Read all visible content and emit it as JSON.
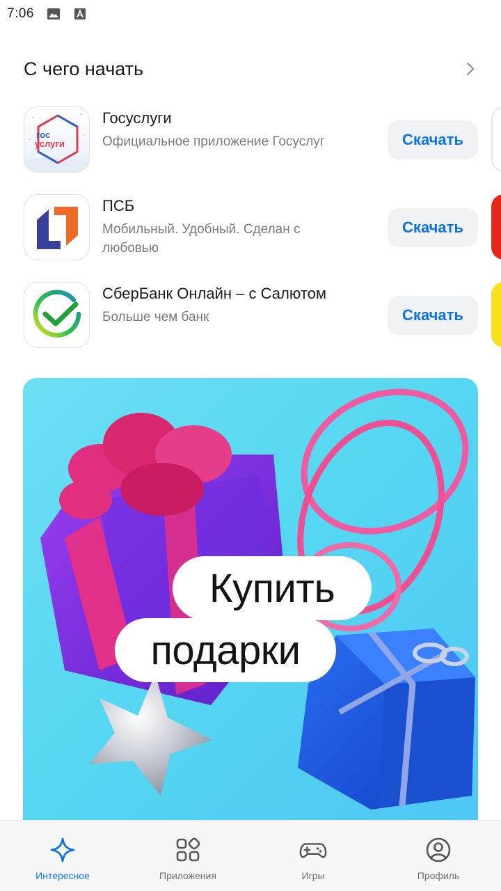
{
  "status_bar": {
    "time": "7:06",
    "icons": [
      "image-icon",
      "font-a-icon"
    ]
  },
  "section": {
    "title": "С чего начать"
  },
  "apps": [
    {
      "name": "Госуслуги",
      "description": "Официальное приложение Госуслуг",
      "button": "Скачать",
      "icon": "gosuslugi-logo",
      "icon_text_1": "гос",
      "icon_text_2": "услуги"
    },
    {
      "name": "ПСБ",
      "description": "Мобильный. Удобный. Сделан с любовью",
      "button": "Скачать",
      "icon": "psb-logo"
    },
    {
      "name": "СберБанк Онлайн – с Салютом",
      "description": "Больше чем банк",
      "button": "Скачать",
      "icon": "sberbank-logo"
    }
  ],
  "banner": {
    "line1": "Купить",
    "line2": "подарки"
  },
  "nav": [
    {
      "label": "Интересное",
      "icon": "sparkle-icon",
      "active": true
    },
    {
      "label": "Приложения",
      "icon": "apps-grid-icon",
      "active": false
    },
    {
      "label": "Игры",
      "icon": "gamepad-icon",
      "active": false
    },
    {
      "label": "Профиль",
      "icon": "profile-icon",
      "active": false
    }
  ],
  "colors": {
    "accent": "#0b74e5",
    "banner_bg": "#55d6f2",
    "button_bg": "#f0f2f5"
  }
}
